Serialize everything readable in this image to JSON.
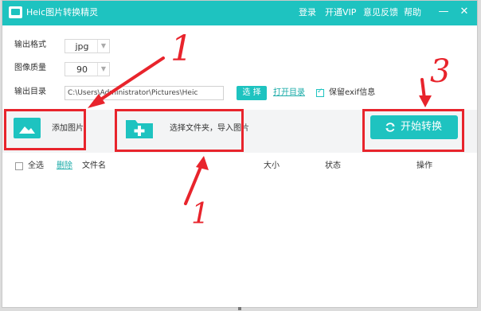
{
  "title_bar": {
    "app_title": "Heic图片转换精灵",
    "links": [
      "登录",
      "开通VIP",
      "意见反馈",
      "帮助"
    ],
    "minimize": "—",
    "close": "✕"
  },
  "settings": {
    "format_label": "输出格式",
    "format_value": "jpg",
    "quality_label": "图像质量",
    "quality_value": "90",
    "dir_label": "输出目录",
    "dir_value": "C:\\Users\\Administrator\\Pictures\\Heic",
    "choose_button": "选 择",
    "open_dir_link": "打开目录",
    "keep_exif_label": "保留exif信息",
    "keep_exif_checked": true
  },
  "toolbar": {
    "add_image": "添加图片",
    "add_folder": "选择文件夹，导入图片",
    "start_button": "开始转换"
  },
  "list_header": {
    "select_all": "全选",
    "delete": "删除",
    "filename": "文件名",
    "size": "大小",
    "status": "状态",
    "action": "操作"
  },
  "annotations": {
    "number_1_top": "1",
    "number_1_bottom": "1",
    "number_3": "3",
    "color": "#e8242c"
  },
  "colors": {
    "accent": "#1ec3c0",
    "link": "#1aaba8",
    "annotation": "#e8242c"
  }
}
